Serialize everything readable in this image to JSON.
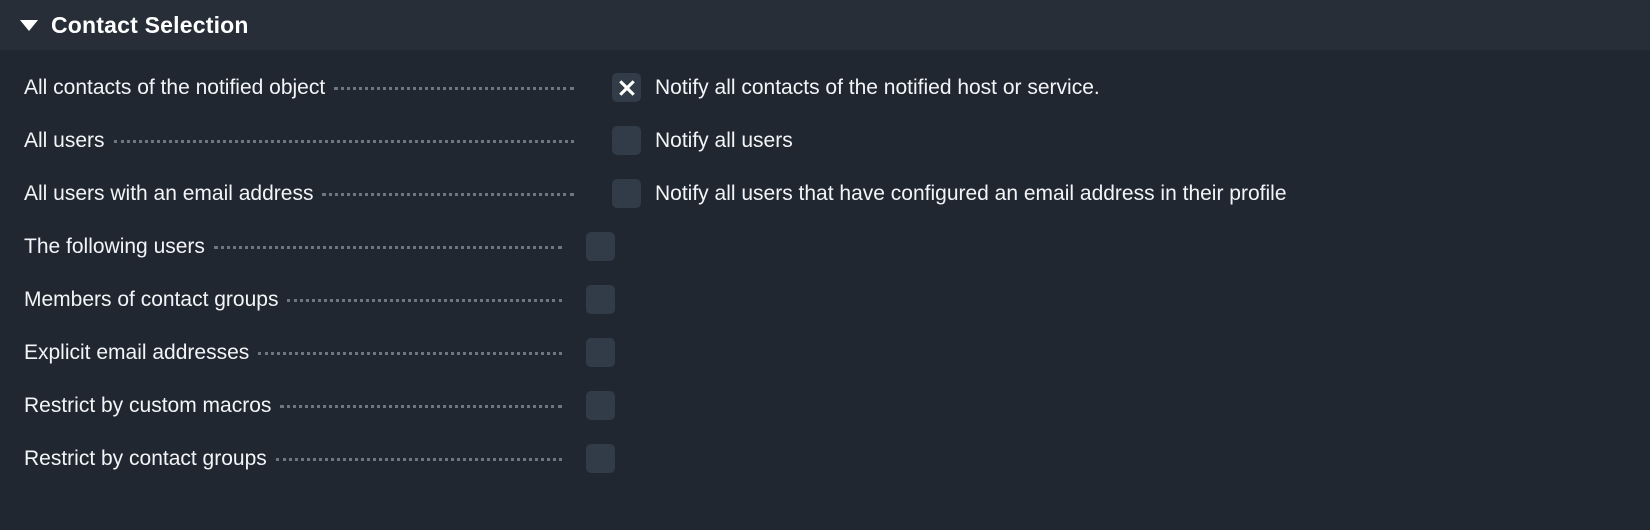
{
  "panel": {
    "title": "Contact Selection",
    "collapse_icon": "triangle-down-icon",
    "expanded": true
  },
  "colors": {
    "background": "#212731",
    "header_background": "#272e38",
    "text": "#f2f4f7",
    "title": "#ffffff",
    "leader_dots": "#6d7683",
    "checkbox_background": "#323b48",
    "checkmark": "#ffffff"
  },
  "rows": [
    {
      "label": "All contacts of the notified object",
      "checkbox_position": "right",
      "checked": true,
      "checkbox_icon": "cross-mark-icon",
      "value_text": "Notify all contacts of the notified host or service."
    },
    {
      "label": "All users",
      "checkbox_position": "right",
      "checked": false,
      "checkbox_icon": "empty-checkbox-icon",
      "value_text": "Notify all users"
    },
    {
      "label": "All users with an email address",
      "checkbox_position": "right",
      "checked": false,
      "checkbox_icon": "empty-checkbox-icon",
      "value_text": "Notify all users that have configured an email address in their profile"
    },
    {
      "label": "The following users",
      "checkbox_position": "inline",
      "checked": false,
      "checkbox_icon": "empty-checkbox-icon",
      "value_text": ""
    },
    {
      "label": "Members of contact groups",
      "checkbox_position": "inline",
      "checked": false,
      "checkbox_icon": "empty-checkbox-icon",
      "value_text": ""
    },
    {
      "label": "Explicit email addresses",
      "checkbox_position": "inline",
      "checked": false,
      "checkbox_icon": "empty-checkbox-icon",
      "value_text": ""
    },
    {
      "label": "Restrict by custom macros",
      "checkbox_position": "inline",
      "checked": false,
      "checkbox_icon": "empty-checkbox-icon",
      "value_text": ""
    },
    {
      "label": "Restrict by contact groups",
      "checkbox_position": "inline",
      "checked": false,
      "checkbox_icon": "empty-checkbox-icon",
      "value_text": ""
    }
  ]
}
